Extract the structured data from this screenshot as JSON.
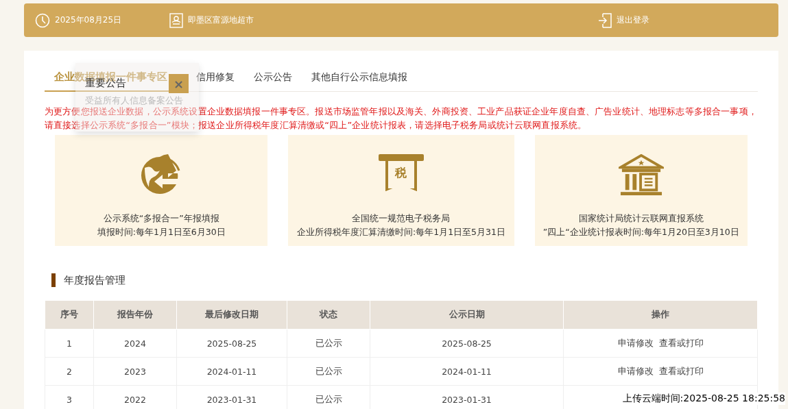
{
  "header": {
    "date": "2025年08月25日",
    "location": "即墨区富源地超市",
    "logout": "退出登录"
  },
  "tabs": [
    {
      "label": "企业数据填报一件事专区",
      "selected": true
    },
    {
      "label": "信用修复",
      "selected": false
    },
    {
      "label": "公示公告",
      "selected": false
    },
    {
      "label": "其他自行公示信息填报",
      "selected": false
    }
  ],
  "notice": "为更方便您报送企业数据，公示系统设置企业数据填报一件事专区。报送市场监管年报以及海关、外商投资、工业产品获证企业年度自查、广告业统计、地理标志等多报合一事项，请直接选择公示系统“多报合一”模块；报送企业所得税年度汇算清缴或“四上”企业统计报表，请选择电子税务局或统计云联网直报系统。",
  "cards": [
    {
      "kind": "globe",
      "title": "公示系统“多报合一”年报填报",
      "subtitle": "填报时间:每年1月1日至6月30日"
    },
    {
      "kind": "tax",
      "icon_char": "税",
      "title": "全国统一规范电子税务局",
      "subtitle": "企业所得税年度汇算清缴时间:每年1月1日至5月31日"
    },
    {
      "kind": "bank",
      "title": "国家统计局统计云联网直报系统",
      "subtitle": "”四上“企业统计报表时间:每年1月20日至3月10日"
    }
  ],
  "section_title": "年度报告管理",
  "table": {
    "columns": [
      "序号",
      "报告年份",
      "最后修改日期",
      "状态",
      "公示日期",
      "操作"
    ],
    "rows": [
      {
        "cells": [
          "1",
          "2024",
          "2025-08-25",
          "已公示",
          "2025-08-25"
        ],
        "actions": [
          "申请修改",
          "查看或打印"
        ]
      },
      {
        "cells": [
          "2",
          "2023",
          "2024-01-11",
          "已公示",
          "2024-01-11"
        ],
        "actions": [
          "申请修改",
          "查看或打印"
        ]
      },
      {
        "cells": [
          "3",
          "2022",
          "2023-01-31",
          "已公示",
          "2023-01-31"
        ]
      }
    ]
  },
  "popup": {
    "title": "重要公告",
    "close": "×",
    "item": "受益所有人信息备案公告"
  },
  "upload_time": "上传云端时间:2025-08-25 18:25:58"
}
